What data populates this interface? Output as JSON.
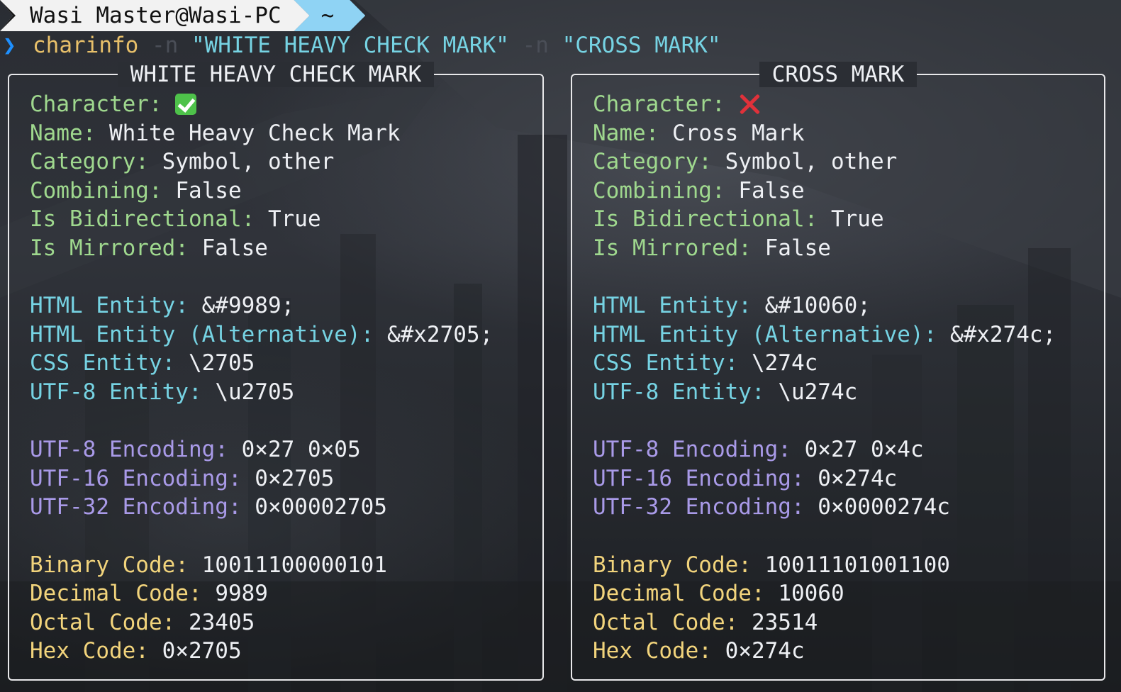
{
  "prompt": {
    "user": "Wasi Master@Wasi-PC",
    "dir": "~"
  },
  "command": {
    "chevron": "❯",
    "name": "charinfo",
    "flag1": "-n",
    "arg1": "\"WHITE HEAVY CHECK MARK\"",
    "flag2": "-n",
    "arg2": "\"CROSS MARK\""
  },
  "panels": [
    {
      "title": "WHITE HEAVY CHECK MARK",
      "icon": "check-mark-icon",
      "character_label": "Character:",
      "name_label": "Name:",
      "name": "White Heavy Check Mark",
      "category_label": "Category:",
      "category": "Symbol, other",
      "combining_label": "Combining:",
      "combining": "False",
      "bidi_label": "Is Bidirectional:",
      "bidi": "True",
      "mirrored_label": "Is Mirrored:",
      "mirrored": "False",
      "html_label": "HTML Entity:",
      "html": "&#9989;",
      "html_alt_label": "HTML Entity (Alternative):",
      "html_alt": "&#x2705;",
      "css_label": "CSS Entity:",
      "css": "\\2705",
      "utf8ent_label": "UTF-8 Entity:",
      "utf8ent": "\\u2705",
      "utf8_label": "UTF-8 Encoding:",
      "utf8": "0×27 0×05",
      "utf16_label": "UTF-16 Encoding:",
      "utf16": "0×2705",
      "utf32_label": "UTF-32 Encoding:",
      "utf32": "0×00002705",
      "binary_label": "Binary Code:",
      "binary": "10011100000101",
      "decimal_label": "Decimal Code:",
      "decimal": "9989",
      "octal_label": "Octal Code:",
      "octal": "23405",
      "hex_label": "Hex Code:",
      "hex": "0×2705"
    },
    {
      "title": "CROSS MARK",
      "icon": "cross-mark-icon",
      "character_label": "Character:",
      "name_label": "Name:",
      "name": "Cross Mark",
      "category_label": "Category:",
      "category": "Symbol, other",
      "combining_label": "Combining:",
      "combining": "False",
      "bidi_label": "Is Bidirectional:",
      "bidi": "True",
      "mirrored_label": "Is Mirrored:",
      "mirrored": "False",
      "html_label": "HTML Entity:",
      "html": "&#10060;",
      "html_alt_label": "HTML Entity (Alternative):",
      "html_alt": "&#x274c;",
      "css_label": "CSS Entity:",
      "css": "\\274c",
      "utf8ent_label": "UTF-8 Entity:",
      "utf8ent": "\\u274c",
      "utf8_label": "UTF-8 Encoding:",
      "utf8": "0×27 0×4c",
      "utf16_label": "UTF-16 Encoding:",
      "utf16": "0×274c",
      "utf32_label": "UTF-32 Encoding:",
      "utf32": "0×0000274c",
      "binary_label": "Binary Code:",
      "binary": "10011101001100",
      "decimal_label": "Decimal Code:",
      "decimal": "10060",
      "octal_label": "Octal Code:",
      "octal": "23514",
      "hex_label": "Hex Code:",
      "hex": "0×274c"
    }
  ],
  "colors": {
    "label_general": "#9fd88e",
    "label_entity": "#76d3e3",
    "label_encoding": "#a99ae8",
    "label_code": "#f2d47c",
    "prompt_dir_bg": "#8fd3f4",
    "command_name": "#e8c06a"
  }
}
